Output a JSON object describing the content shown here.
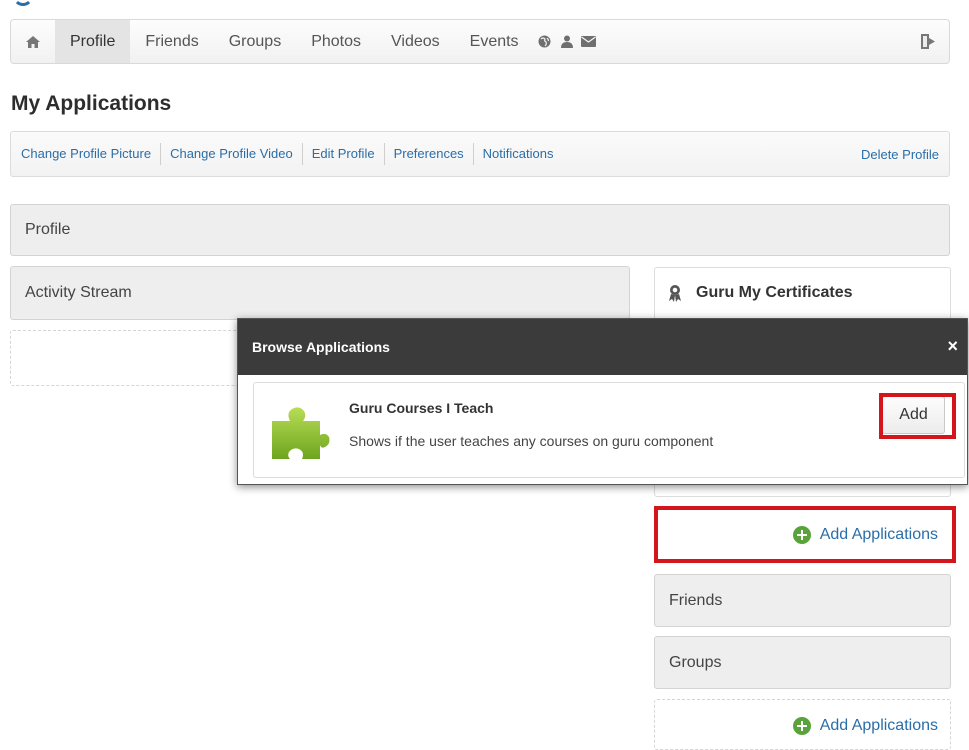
{
  "nav": {
    "items": [
      {
        "label": "Profile",
        "active": true
      },
      {
        "label": "Friends"
      },
      {
        "label": "Groups"
      },
      {
        "label": "Photos"
      },
      {
        "label": "Videos"
      },
      {
        "label": "Events"
      }
    ],
    "icons": [
      "home-icon",
      "globe-icon",
      "user-icon",
      "envelope-icon",
      "logout-icon"
    ]
  },
  "page": {
    "title": "My Applications"
  },
  "submenu": {
    "links": [
      "Change Profile Picture",
      "Change Profile Video",
      "Edit Profile",
      "Preferences",
      "Notifications"
    ],
    "delete": "Delete Profile"
  },
  "main": {
    "profile_label": "Profile",
    "activity_label": "Activity Stream"
  },
  "sidebar": {
    "certificates_title": "Guru My Certificates",
    "add_applications": "Add Applications",
    "friends_label": "Friends",
    "groups_label": "Groups",
    "add_applications_2": "Add Applications"
  },
  "modal": {
    "title": "Browse Applications",
    "close": "×",
    "app": {
      "name": "Guru Courses I Teach",
      "description": "Shows if the user teaches any courses on guru component",
      "add_label": "Add"
    }
  },
  "colors": {
    "link": "#2a6ea8",
    "highlight": "#d3161c",
    "modal_header": "#3b3b3b",
    "add_icon": "#5aa33a"
  }
}
